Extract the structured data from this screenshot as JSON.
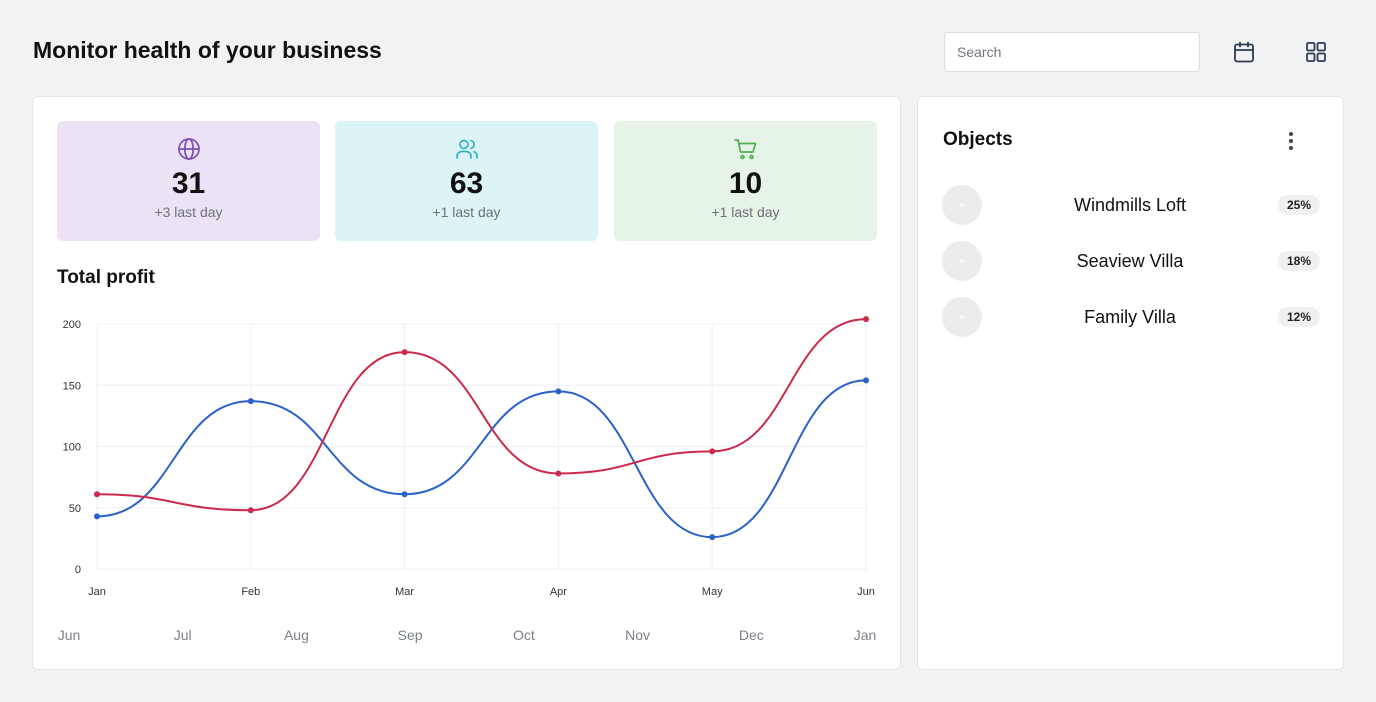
{
  "header": {
    "title": "Monitor health of your business",
    "search_placeholder": "Search"
  },
  "stats": [
    {
      "icon": "globe-icon",
      "value": "31",
      "sub": "+3 last day",
      "bg": "#ebe3f5",
      "icon_color": "#7a4fb5"
    },
    {
      "icon": "users-icon",
      "value": "63",
      "sub": "+1 last day",
      "bg": "#dcf4f6",
      "icon_color": "#2bb3c4"
    },
    {
      "icon": "cart-icon",
      "value": "10",
      "sub": "+1 last day",
      "bg": "#e5f4e6",
      "icon_color": "#4caf50"
    }
  ],
  "chart_title": "Total profit",
  "chart_data": {
    "type": "line",
    "categories": [
      "Jan",
      "Feb",
      "Mar",
      "Apr",
      "May",
      "Jun"
    ],
    "secondary_x_labels": [
      "Jun",
      "Jul",
      "Aug",
      "Sep",
      "Oct",
      "Nov",
      "Dec",
      "Jan"
    ],
    "series": [
      {
        "color": "#2a62c9",
        "values": [
          43,
          137,
          61,
          145,
          26,
          154
        ]
      },
      {
        "color": "#cc2a4c",
        "values": [
          61,
          48,
          177,
          78,
          96,
          204
        ]
      }
    ],
    "ylim": [
      0,
      200
    ],
    "yticks": [
      "0",
      "50",
      "100",
      "150",
      "200"
    ],
    "grid": true,
    "legend": "none"
  },
  "objects": {
    "title": "Objects",
    "items": [
      {
        "name": "Windmills Loft",
        "pct": "25%"
      },
      {
        "name": "Seaview Villa",
        "pct": "18%"
      },
      {
        "name": "Family Villa",
        "pct": "12%"
      }
    ]
  }
}
